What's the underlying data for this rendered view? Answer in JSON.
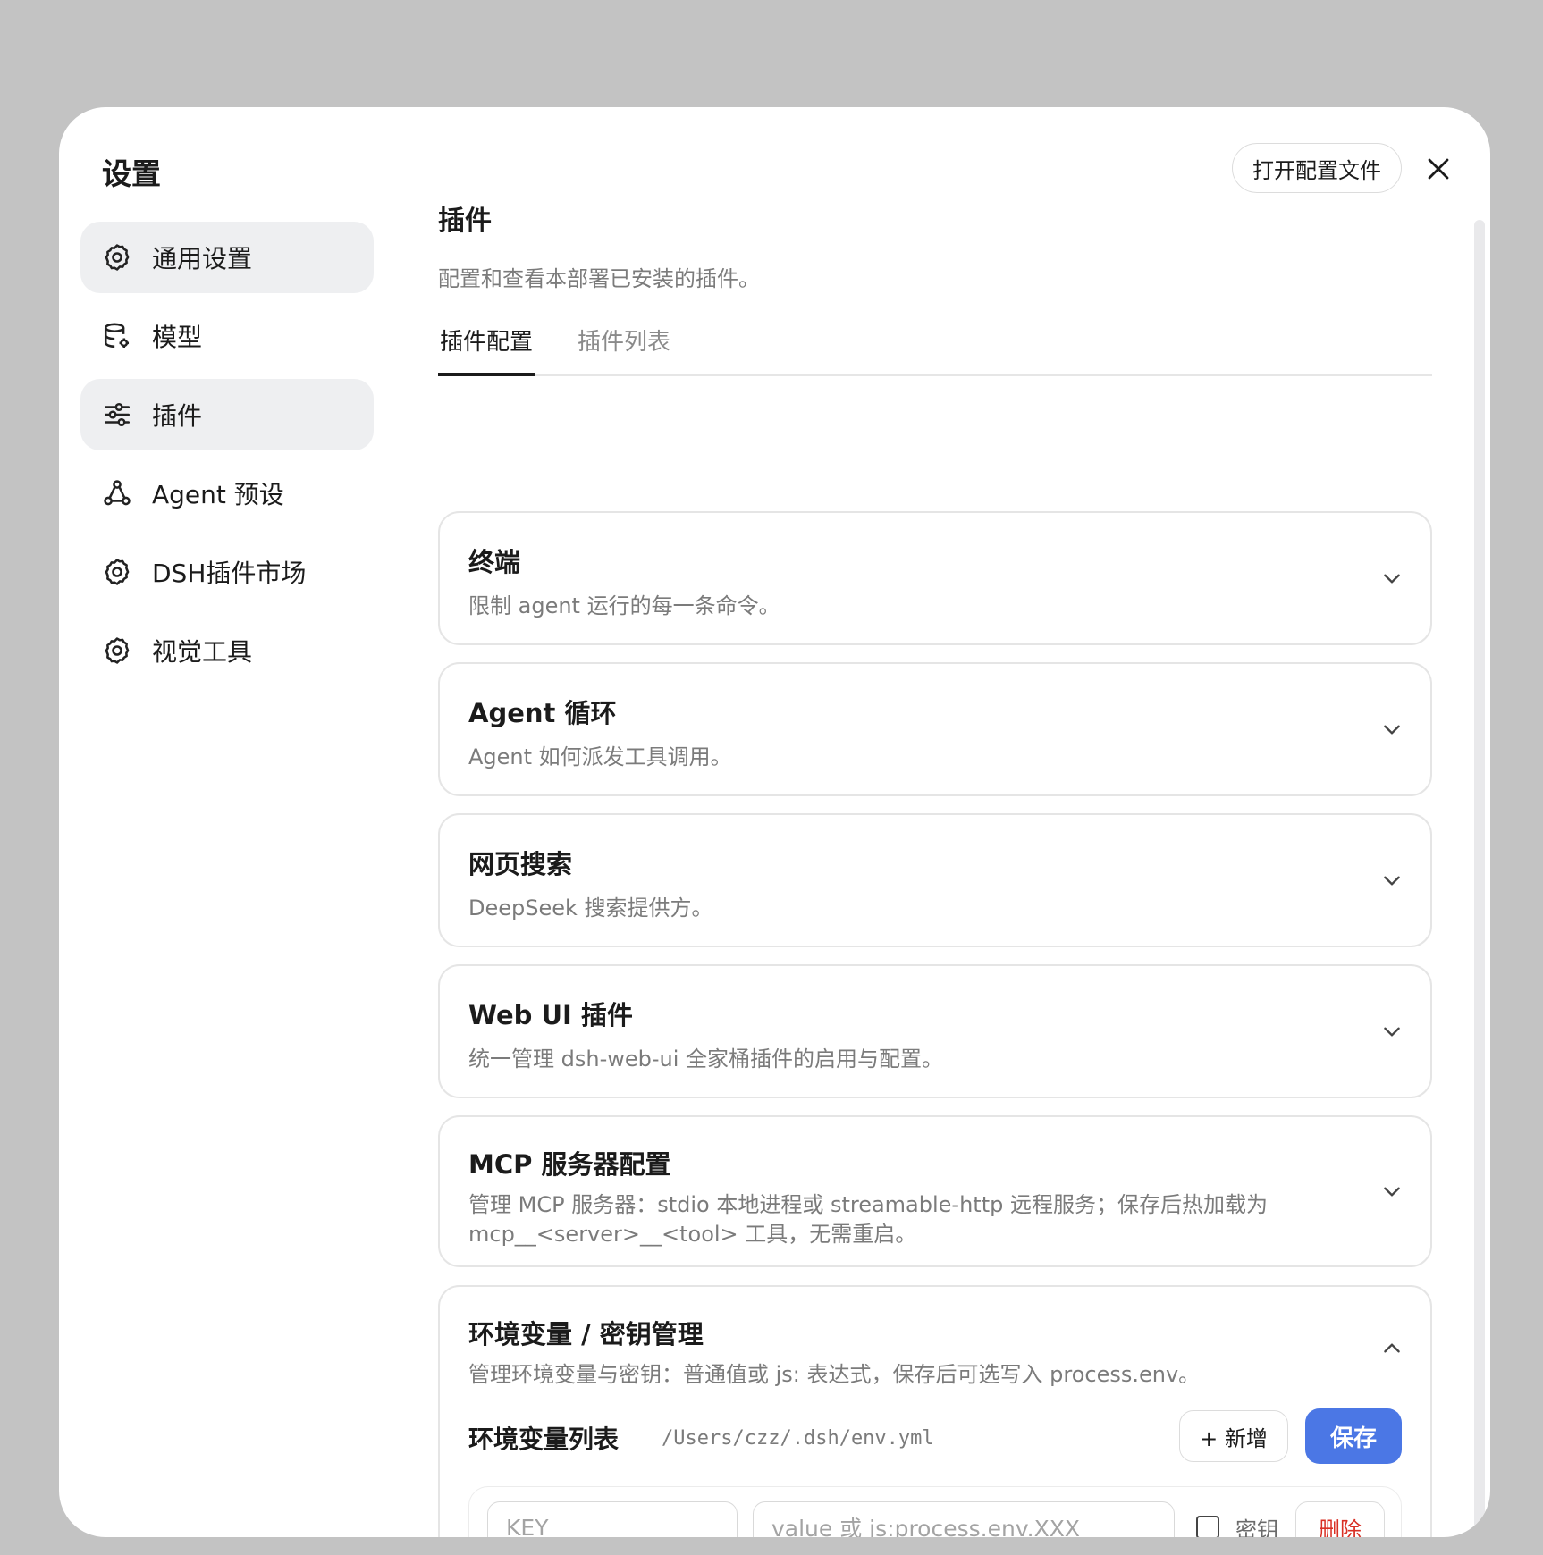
{
  "dialog": {
    "title": "设置",
    "open_config_label": "打开配置文件"
  },
  "sidebar": {
    "items": [
      {
        "label": "通用设置",
        "icon": "gear-icon"
      },
      {
        "label": "模型",
        "icon": "database-gear-icon"
      },
      {
        "label": "插件",
        "icon": "sliders-icon"
      },
      {
        "label": "Agent 预设",
        "icon": "agent-nodes-icon"
      },
      {
        "label": "DSH插件市场",
        "icon": "gear-icon"
      },
      {
        "label": "视觉工具",
        "icon": "gear-icon"
      }
    ]
  },
  "main": {
    "title": "插件",
    "description": "配置和查看本部署已安装的插件。",
    "tabs": [
      {
        "label": "插件配置",
        "active": true
      },
      {
        "label": "插件列表",
        "active": false
      }
    ],
    "cards": [
      {
        "title": "终端",
        "description": "限制 agent 运行的每一条命令。"
      },
      {
        "title": "Agent 循环",
        "description": "Agent 如何派发工具调用。"
      },
      {
        "title": "网页搜索",
        "description": "DeepSeek 搜索提供方。"
      },
      {
        "title": "Web UI 插件",
        "description": "统一管理 dsh-web-ui 全家桶插件的启用与配置。"
      },
      {
        "title": "MCP 服务器配置",
        "description": "管理 MCP 服务器：stdio 本地进程或 streamable-http 远程服务；保存后热加载为 mcp__<server>__<tool> 工具，无需重启。"
      },
      {
        "title": "环境变量 / 密钥管理",
        "description": "管理环境变量与密钥：普通值或 js: 表达式，保存后可选写入 process.env。"
      }
    ],
    "env": {
      "list_title": "环境变量列表",
      "path": "/Users/czz/.dsh/env.yml",
      "add_label": "+ 新增",
      "save_label": "保存",
      "key_placeholder": "KEY",
      "value_placeholder": "value 或 js:process.env.XXX",
      "secret_label": "密钥",
      "delete_label": "删除"
    }
  },
  "colors": {
    "backdrop": "#c3c3c3",
    "accent": "#4b77e5",
    "danger": "#d93025",
    "sidebar_highlight": "#eeeff1"
  }
}
